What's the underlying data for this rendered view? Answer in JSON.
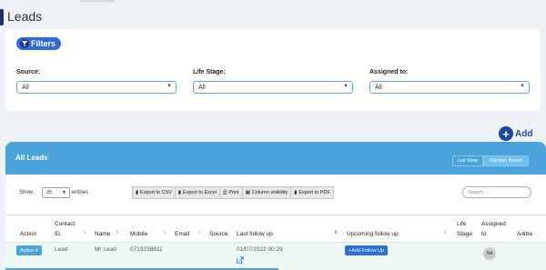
{
  "page": {
    "title": "Leads"
  },
  "filters": {
    "button_label": "Filters",
    "fields": [
      {
        "label": "Source:",
        "value": "All"
      },
      {
        "label": "Life Stage:",
        "value": "All"
      },
      {
        "label": "Assigned to:",
        "value": "All"
      }
    ]
  },
  "add": {
    "label": "Add"
  },
  "leads": {
    "title": "All Leads",
    "views": [
      {
        "label": "List View",
        "active": false
      },
      {
        "label": "Kanban Board",
        "active": true
      }
    ],
    "show_label": "Show",
    "page_size": "25",
    "entries_label": "entries",
    "exports": [
      {
        "icon": "file-icon",
        "label": "Export to CSV"
      },
      {
        "icon": "file-icon",
        "label": "Export to Excel"
      },
      {
        "icon": "print-icon",
        "label": "Print"
      },
      {
        "icon": "columns-icon",
        "label": "Column visibility"
      },
      {
        "icon": "file-icon",
        "label": "Export to PDF"
      }
    ],
    "search_placeholder": "Search ...",
    "columns": {
      "action": "Action",
      "contact_id_1": "Contact",
      "contact_id_2": "ID",
      "name": "Name",
      "mobile": "Mobile",
      "email": "Email",
      "source": "Source",
      "last_follow_up": "Last follow up",
      "upcoming_follow_up": "Upcoming follow up",
      "life_stage_1": "Life",
      "life_stage_2": "Stage",
      "assigned_to_1": "Assigned",
      "assigned_to_2": "to",
      "address": "Addre"
    },
    "row": {
      "action_label": "Action",
      "contact_id": "Lead",
      "name": "Mr Lead",
      "mobile": "0719238811",
      "last_follow_up": "01/07/2022 00:29",
      "add_follow_up_label": "+Add Follow Up",
      "assigned_initials": "NA"
    }
  },
  "colors": {
    "accent": "#4aa3db",
    "primary": "#1a47a8",
    "row_highlight": "#eef9f6"
  }
}
